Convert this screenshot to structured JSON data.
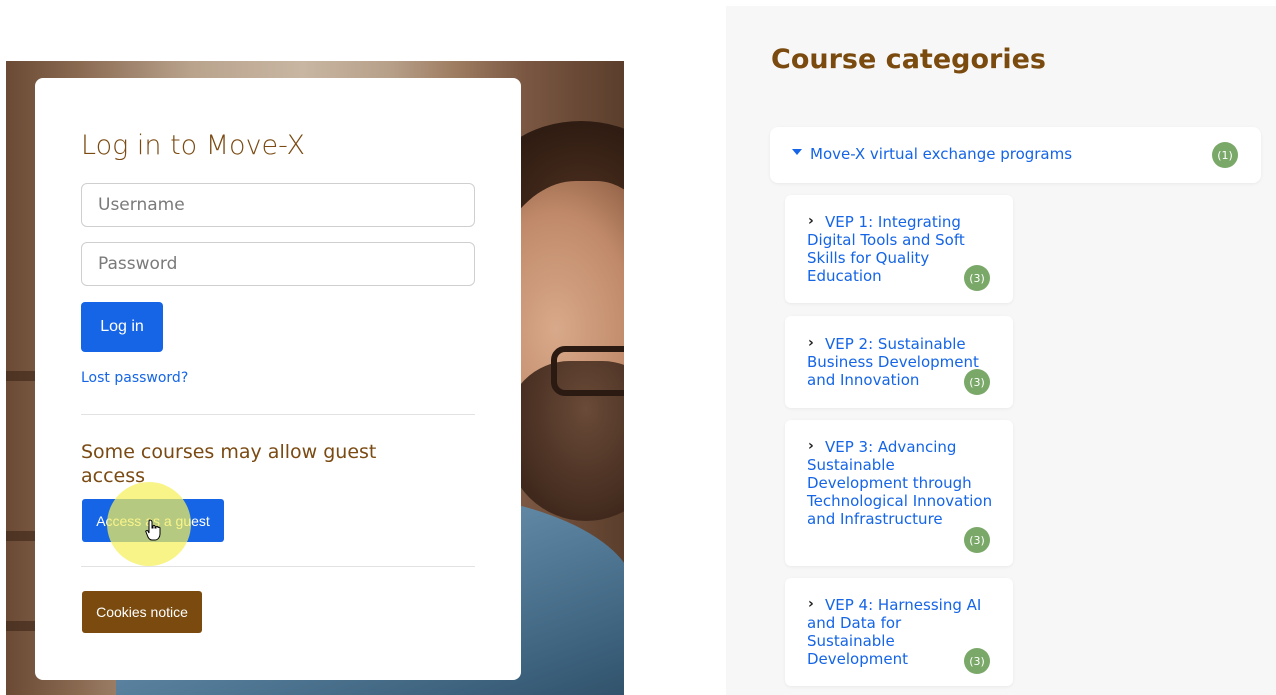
{
  "login": {
    "title": "Log in to Move-X",
    "username_placeholder": "Username",
    "password_placeholder": "Password",
    "login_button": "Log in",
    "lost_password": "Lost password?",
    "guest_text": "Some courses may allow guest access",
    "guest_button": "Access as a guest",
    "cookies_button": "Cookies notice"
  },
  "categories": {
    "title": "Course categories",
    "parent": {
      "label": "Move-X virtual exchange programs",
      "count": "(1)"
    },
    "items": [
      {
        "label": "VEP 1: Integrating Digital Tools and Soft Skills for Quality Education",
        "count": "(3)"
      },
      {
        "label": "VEP 2: Sustainable Business Development and Innovation",
        "count": "(3)"
      },
      {
        "label": "VEP 3: Advancing Sustainable Development through Technological Innovation and Infrastructure",
        "count": "(3)"
      },
      {
        "label": "VEP 4: Harnessing AI and Data for Sustainable Development",
        "count": "(3)"
      }
    ]
  },
  "colors": {
    "accent_blue": "#1565e6",
    "brand_brown": "#7a4a0e",
    "badge_green": "#7aa868"
  }
}
